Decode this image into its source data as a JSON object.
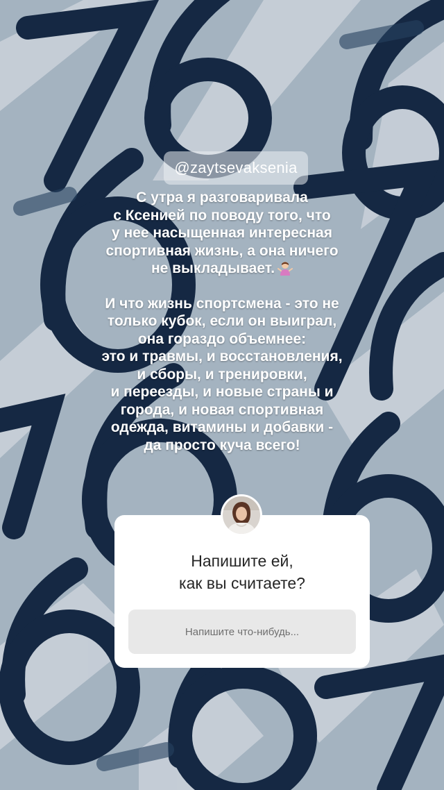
{
  "story": {
    "mention": "@zaytsevaksenia",
    "caption_p1": "С утра я разговаривала\nс Ксенией по поводу того, что\nу нее насыщенная интересная\nспортивная жизнь, а она ничего\nне выкладывает.",
    "caption_p1_emoji": "woman-shrugging-emoji",
    "caption_p2": "И что жизнь спортсмена - это не\nтолько кубок, если он выиграл,\nона гораздо объемнее:\nэто и травмы, и восстановления,\nи сборы, и тренировки,\nи переезды, и новые страны и\nгорода, и новая спортивная\nодежда, витамины и добавки -\nда просто куча всего!"
  },
  "question_sticker": {
    "avatar": "profile-avatar",
    "question": "Напишите ей,\nкак вы считаете?",
    "input_placeholder": "Напишите что-нибудь..."
  },
  "colors": {
    "background": "#b8c6d2",
    "digits": "#162a45",
    "card": "#ffffff",
    "input": "#e8e8e8"
  }
}
